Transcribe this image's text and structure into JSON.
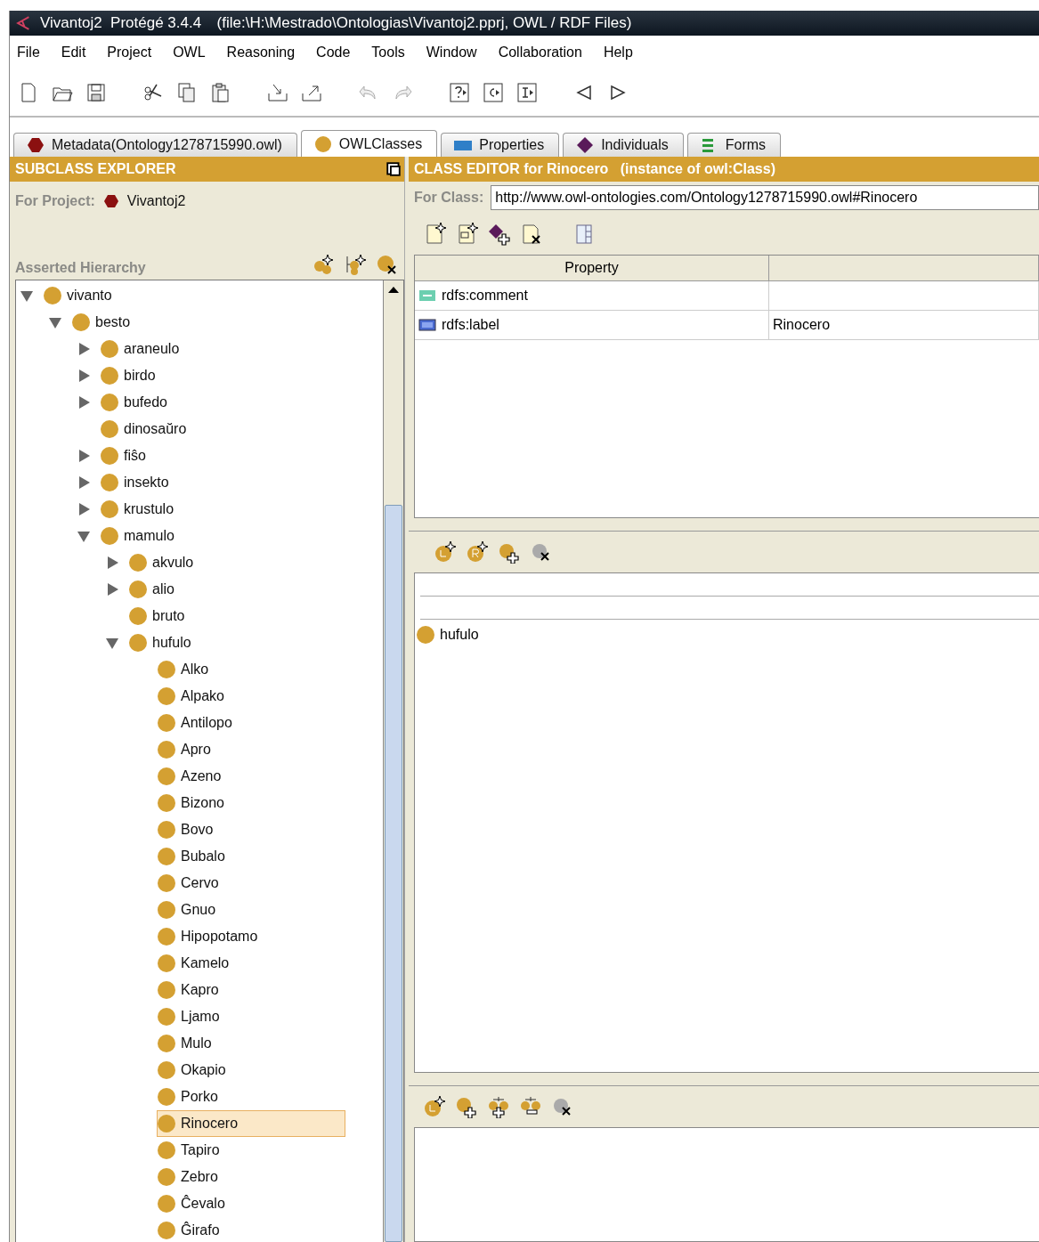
{
  "window": {
    "title": "Vivantoj2  Protégé 3.4.4",
    "subtitle": "(file:\\H:\\Mestrado\\Ontologias\\Vivantoj2.pprj, OWL / RDF Files)"
  },
  "menu": [
    {
      "label": "File"
    },
    {
      "label": "Edit"
    },
    {
      "label": "Project"
    },
    {
      "label": "OWL"
    },
    {
      "label": "Reasoning"
    },
    {
      "label": "Code"
    },
    {
      "label": "Tools"
    },
    {
      "label": "Window"
    },
    {
      "label": "Collaboration"
    },
    {
      "label": "Help"
    }
  ],
  "tabs": [
    {
      "label": "Metadata(Ontology1278715990.owl)",
      "kind": "metadata",
      "selected": false
    },
    {
      "label": "OWLClasses",
      "kind": "classes",
      "selected": true
    },
    {
      "label": "Properties",
      "kind": "properties",
      "selected": false
    },
    {
      "label": "Individuals",
      "kind": "individuals",
      "selected": false
    },
    {
      "label": "Forms",
      "kind": "forms",
      "selected": false
    }
  ],
  "subclass_explorer": {
    "title": "SUBCLASS EXPLORER",
    "project_label": "For Project:",
    "project": "Vivantoj2",
    "hierarchy_label": "Asserted Hierarchy",
    "tree": [
      {
        "label": "vivanto",
        "expanded": true,
        "selected": false,
        "children": [
          {
            "label": "besto",
            "expanded": true,
            "selected": false,
            "children": [
              {
                "label": "araneulo",
                "expanded": false,
                "selected": false
              },
              {
                "label": "birdo",
                "expanded": false,
                "selected": false
              },
              {
                "label": "bufedo",
                "expanded": false,
                "selected": false
              },
              {
                "label": "dinosaŭro",
                "selected": false
              },
              {
                "label": "fiŝo",
                "expanded": false,
                "selected": false
              },
              {
                "label": "insekto",
                "expanded": false,
                "selected": false
              },
              {
                "label": "krustulo",
                "expanded": false,
                "selected": false
              },
              {
                "label": "mamulo",
                "expanded": true,
                "selected": false,
                "children": [
                  {
                    "label": "akvulo",
                    "expanded": false,
                    "selected": false
                  },
                  {
                    "label": "alio",
                    "expanded": false,
                    "selected": false
                  },
                  {
                    "label": "bruto",
                    "selected": false
                  },
                  {
                    "label": "hufulo",
                    "expanded": true,
                    "selected": false,
                    "children": [
                      {
                        "label": "Alko",
                        "selected": false
                      },
                      {
                        "label": "Alpako",
                        "selected": false
                      },
                      {
                        "label": "Antilopo",
                        "selected": false
                      },
                      {
                        "label": "Apro",
                        "selected": false
                      },
                      {
                        "label": "Azeno",
                        "selected": false
                      },
                      {
                        "label": "Bizono",
                        "selected": false
                      },
                      {
                        "label": "Bovo",
                        "selected": false
                      },
                      {
                        "label": "Bubalo",
                        "selected": false
                      },
                      {
                        "label": "Cervo",
                        "selected": false
                      },
                      {
                        "label": "Gnuo",
                        "selected": false
                      },
                      {
                        "label": "Hipopotamo",
                        "selected": false
                      },
                      {
                        "label": "Kamelo",
                        "selected": false
                      },
                      {
                        "label": "Kapro",
                        "selected": false
                      },
                      {
                        "label": "Ljamo",
                        "selected": false
                      },
                      {
                        "label": "Mulo",
                        "selected": false
                      },
                      {
                        "label": "Okapio",
                        "selected": false
                      },
                      {
                        "label": "Porko",
                        "selected": false
                      },
                      {
                        "label": "Rinocero",
                        "selected": true
                      },
                      {
                        "label": "Tapiro",
                        "selected": false
                      },
                      {
                        "label": "Zebro",
                        "selected": false
                      },
                      {
                        "label": "Ĉevalo",
                        "selected": false
                      },
                      {
                        "label": "Ĝirafo",
                        "selected": false
                      }
                    ]
                  }
                ]
              }
            ]
          }
        ]
      }
    ]
  },
  "class_editor": {
    "title": "CLASS EDITOR for Rinocero   (instance of owl:Class)",
    "for_class_label": "For Class:",
    "for_class": "http://www.owl-ontologies.com/Ontology1278715990.owl#Rinocero",
    "table": {
      "columns": [
        {
          "label": "Property"
        }
      ],
      "rows": [
        {
          "kind": "comment",
          "property": "rdfs:comment"
        },
        {
          "kind": "label",
          "property": "rdfs:label",
          "value": "Rinocero"
        }
      ]
    },
    "superclasses": [
      {
        "label": "hufulo"
      }
    ]
  }
}
